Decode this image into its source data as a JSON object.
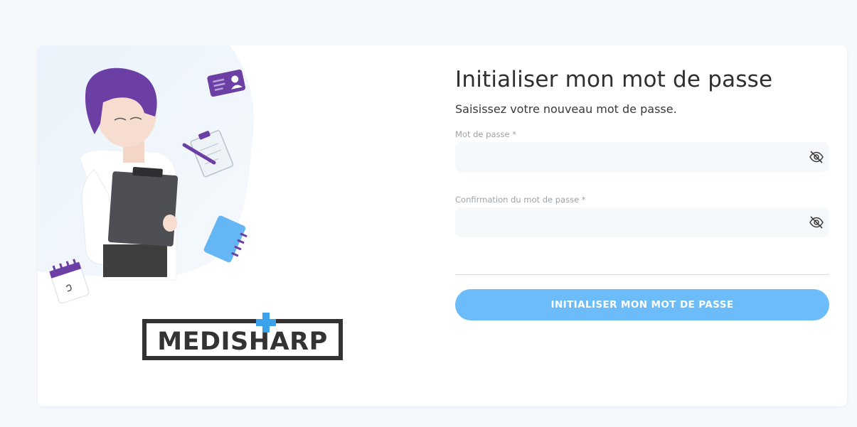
{
  "branding": {
    "logo_text": "MEDISHARP"
  },
  "form": {
    "title": "Initialiser mon mot de passe",
    "subtitle": "Saisissez votre nouveau mot de passe.",
    "password": {
      "label": "Mot de passe *",
      "value": "",
      "toggle_icon": "eye-off-icon"
    },
    "confirm": {
      "label": "Confirmation du mot de passe *",
      "value": "",
      "toggle_icon": "eye-off-icon"
    },
    "submit_label": "INITIALISER MON MOT DE PASSE"
  },
  "colors": {
    "page_background": "#f5f9fc",
    "input_background": "#f5f9fc",
    "button": "#6cbcf9",
    "logo_dark": "#333333",
    "logo_cross": "#3aa3ec",
    "avatar_hair": "#6c3fa5"
  }
}
